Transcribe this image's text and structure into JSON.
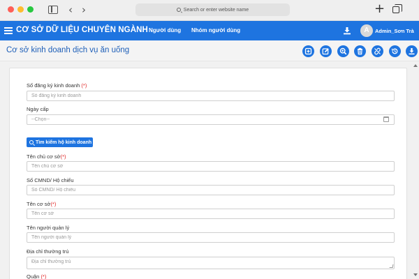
{
  "browser": {
    "url_placeholder": "Search or enter website name"
  },
  "navbar": {
    "title": "CƠ SỞ DỮ LIỆU CHUYÊN NGÀNH",
    "links": [
      "Người dùng",
      "Nhóm người dùng"
    ],
    "avatar_letter": "A",
    "user_name": "Admin_Sơn Trà",
    "brand_color": "#1e74e0"
  },
  "page": {
    "title": "Cơ sở kinh doanh dịch vụ ăn uống",
    "actions": [
      "add-icon",
      "edit-icon",
      "search-icon",
      "delete-icon",
      "unlink-icon",
      "history-icon",
      "download-icon"
    ]
  },
  "form": {
    "business_reg": {
      "label": "Số đăng ký kinh doanh ",
      "required_mark": "(*)",
      "placeholder": "Số đăng ký kinh doanh"
    },
    "issue_date": {
      "label": "Ngày cấp",
      "placeholder": "--Chọn--"
    },
    "search_button": "Tìm kiếm hộ kinh doanh",
    "owner": {
      "label": "Tên chủ cơ sở",
      "required_mark": "(*)",
      "placeholder": "Tên chủ cơ sở"
    },
    "id_number": {
      "label": "Số CMND/ Hộ chiếu",
      "placeholder": "Số CMND/ Hộ chiếu"
    },
    "facility_name": {
      "label": "Tên cơ sở",
      "required_mark": "(*)",
      "placeholder": "Tên cơ sở"
    },
    "manager": {
      "label": "Tên người quản lý",
      "placeholder": "Tên người quản lý"
    },
    "address": {
      "label": "Địa chỉ thường trú",
      "placeholder": "Địa chỉ thường trú"
    },
    "district": {
      "label": "Quận ",
      "required_mark": "(*)"
    }
  }
}
